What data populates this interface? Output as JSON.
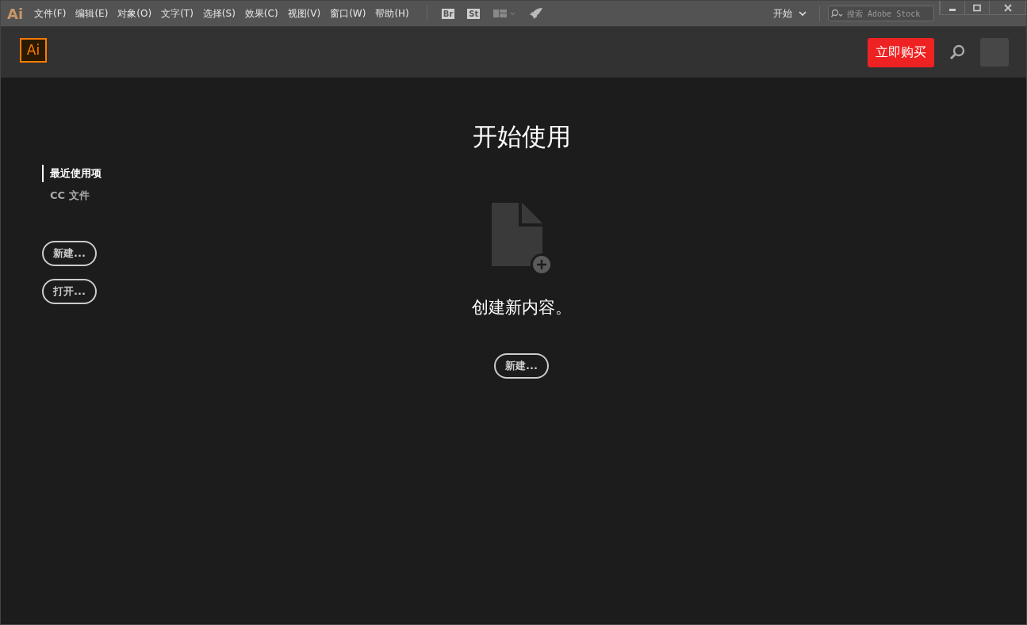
{
  "menubar": {
    "app_logo": "Ai",
    "menus": [
      "文件(F)",
      "编辑(E)",
      "对象(O)",
      "文字(T)",
      "选择(S)",
      "效果(C)",
      "视图(V)",
      "窗口(W)",
      "帮助(H)"
    ],
    "bridge_button": "Br",
    "stock_button": "St",
    "workspace": "开始",
    "search": {
      "placeholder": "搜索 Adobe Stock"
    }
  },
  "header": {
    "logo": "Ai",
    "buy_button": "立即购买"
  },
  "sidebar": {
    "items": [
      {
        "label": "最近使用项",
        "selected": true
      },
      {
        "label": "CC 文件",
        "selected": false
      }
    ],
    "buttons": [
      "新建...",
      "打开..."
    ]
  },
  "main": {
    "title": "开始使用",
    "subtitle": "创建新内容。",
    "button": "新建..."
  }
}
